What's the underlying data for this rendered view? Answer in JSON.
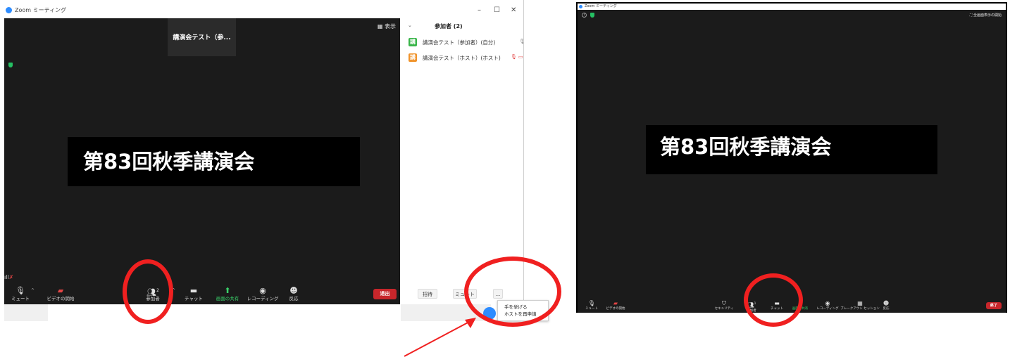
{
  "left_window": {
    "title": "Zoom ミーティング",
    "controls": {
      "minimize": "–",
      "maximize": "☐",
      "close": "✕"
    },
    "video": {
      "name_card": "講演会テスト（参...",
      "view_button": "▦ 表示",
      "banner": "第83回秋季講演会"
    },
    "toolbar": {
      "mute": "ミュート",
      "start_video": "ビデオの開始",
      "participants": "参加者",
      "participants_count": "2",
      "chat": "チャット",
      "share_screen": "画面の共有",
      "recording": "レコーディング",
      "reactions": "反応",
      "leave": "退出"
    },
    "participants_panel": {
      "title": "参加者 (2)",
      "items": [
        {
          "avatar": "講",
          "name": "講演会テスト（参加者）(自分)",
          "avatar_color": "#3ab54a"
        },
        {
          "avatar": "講",
          "name": "講演会テスト（ホスト）(ホスト)",
          "avatar_color": "#f0932b"
        }
      ],
      "invite": "招待",
      "mute": "ミュート",
      "more": "..."
    },
    "popup_menu": [
      "手を挙げる",
      "ホストを再申請"
    ]
  },
  "right_window": {
    "title": "Zoom ミーティング",
    "fullscreen": "⛶ 全画面表示の開始",
    "banner": "第83回秋季講演会",
    "toolbar": {
      "mute": "ミュート",
      "start_video": "ビデオの開始",
      "security": "セキュリティ",
      "participants": "参加者",
      "participants_count": "1",
      "chat": "チャット",
      "share_screen": "画面の共有",
      "recording": "レコーディング",
      "breakout": "ブレークアウト セッション",
      "reactions": "反応",
      "end": "終了"
    }
  },
  "colors": {
    "annotation_red": "#f02020",
    "zoom_blue": "#2d8cff",
    "leave_red": "#c7262b",
    "share_green": "#3ad26a"
  }
}
